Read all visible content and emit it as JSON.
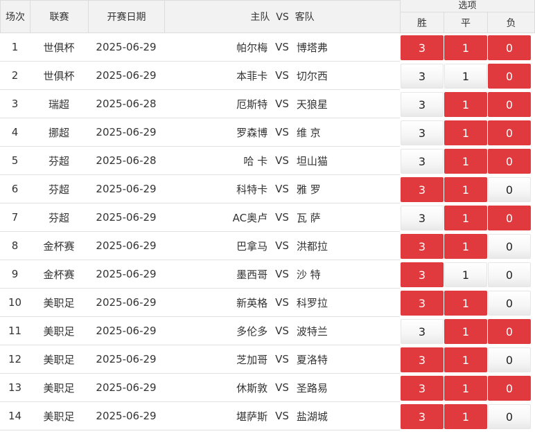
{
  "headers": {
    "round": "场次",
    "league": "联赛",
    "date": "开赛日期",
    "teams": "主队  VS  客队",
    "options": "选项",
    "win": "胜",
    "draw": "平",
    "lose": "负"
  },
  "vs_label": "VS",
  "colors": {
    "selected": "#e03a3f",
    "unselected": "#f3f3f3"
  },
  "rows": [
    {
      "no": "1",
      "league": "世俱杯",
      "date": "2025-06-29",
      "home": "帕尔梅",
      "away": "博塔弗",
      "win": "3",
      "draw": "1",
      "lose": "0",
      "sel": [
        true,
        true,
        true
      ]
    },
    {
      "no": "2",
      "league": "世俱杯",
      "date": "2025-06-29",
      "home": "本菲卡",
      "away": "切尔西",
      "win": "3",
      "draw": "1",
      "lose": "0",
      "sel": [
        false,
        false,
        true
      ]
    },
    {
      "no": "3",
      "league": "瑞超",
      "date": "2025-06-28",
      "home": "厄斯特",
      "away": "天狼星",
      "win": "3",
      "draw": "1",
      "lose": "0",
      "sel": [
        false,
        true,
        true
      ]
    },
    {
      "no": "4",
      "league": "挪超",
      "date": "2025-06-29",
      "home": "罗森博",
      "away": "维 京",
      "win": "3",
      "draw": "1",
      "lose": "0",
      "sel": [
        false,
        true,
        true
      ]
    },
    {
      "no": "5",
      "league": "芬超",
      "date": "2025-06-28",
      "home": "哈 卡",
      "away": "坦山猫",
      "win": "3",
      "draw": "1",
      "lose": "0",
      "sel": [
        false,
        true,
        true
      ]
    },
    {
      "no": "6",
      "league": "芬超",
      "date": "2025-06-29",
      "home": "科特卡",
      "away": "雅 罗",
      "win": "3",
      "draw": "1",
      "lose": "0",
      "sel": [
        true,
        true,
        false
      ]
    },
    {
      "no": "7",
      "league": "芬超",
      "date": "2025-06-29",
      "home": "AC奥卢",
      "away": "瓦 萨",
      "win": "3",
      "draw": "1",
      "lose": "0",
      "sel": [
        false,
        true,
        true
      ]
    },
    {
      "no": "8",
      "league": "金杯赛",
      "date": "2025-06-29",
      "home": "巴拿马",
      "away": "洪都拉",
      "win": "3",
      "draw": "1",
      "lose": "0",
      "sel": [
        true,
        true,
        false
      ]
    },
    {
      "no": "9",
      "league": "金杯赛",
      "date": "2025-06-29",
      "home": "墨西哥",
      "away": "沙 特",
      "win": "3",
      "draw": "1",
      "lose": "0",
      "sel": [
        true,
        false,
        false
      ]
    },
    {
      "no": "10",
      "league": "美职足",
      "date": "2025-06-29",
      "home": "新英格",
      "away": "科罗拉",
      "win": "3",
      "draw": "1",
      "lose": "0",
      "sel": [
        true,
        true,
        false
      ]
    },
    {
      "no": "11",
      "league": "美职足",
      "date": "2025-06-29",
      "home": "多伦多",
      "away": "波特兰",
      "win": "3",
      "draw": "1",
      "lose": "0",
      "sel": [
        false,
        true,
        true
      ]
    },
    {
      "no": "12",
      "league": "美职足",
      "date": "2025-06-29",
      "home": "芝加哥",
      "away": "夏洛特",
      "win": "3",
      "draw": "1",
      "lose": "0",
      "sel": [
        true,
        true,
        false
      ]
    },
    {
      "no": "13",
      "league": "美职足",
      "date": "2025-06-29",
      "home": "休斯敦",
      "away": "圣路易",
      "win": "3",
      "draw": "1",
      "lose": "0",
      "sel": [
        true,
        true,
        true
      ]
    },
    {
      "no": "14",
      "league": "美职足",
      "date": "2025-06-29",
      "home": "堪萨斯",
      "away": "盐湖城",
      "win": "3",
      "draw": "1",
      "lose": "0",
      "sel": [
        true,
        true,
        false
      ]
    }
  ]
}
